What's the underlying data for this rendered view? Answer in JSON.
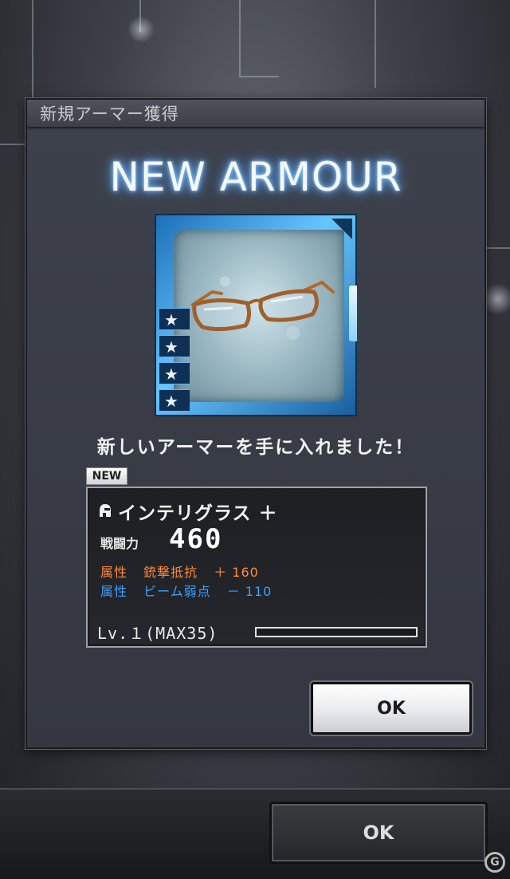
{
  "dialog": {
    "title": "新規アーマー獲得",
    "banner": "NEW ARMOUR",
    "message": "新しいアーマーを手に入れました！",
    "new_badge": "NEW",
    "ok_label": "OK"
  },
  "item": {
    "rarity_stars": 4,
    "name": "インテリグラス ＋",
    "power_label": "戦闘力",
    "power_value": "460",
    "attributes": [
      {
        "label": "属性",
        "name": "銃撃抵抗",
        "value": "＋ 160",
        "color": "#ff8a3c"
      },
      {
        "label": "属性",
        "name": "ビーム弱点",
        "value": "－ 110",
        "color": "#3fa0ff"
      }
    ],
    "level_text": "Lv.１(MAX35)",
    "level_progress": 0
  },
  "background": {
    "ok_label": "OK",
    "watermark": "G"
  },
  "colors": {
    "banner_glow": "#6fb6ff",
    "frame_blue": "#66c6ff"
  }
}
